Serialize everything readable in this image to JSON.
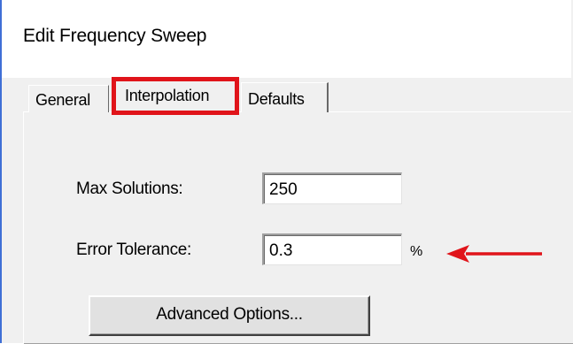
{
  "dialog": {
    "title": "Edit Frequency Sweep"
  },
  "tabs": [
    {
      "label": "General",
      "active": false
    },
    {
      "label": "Interpolation",
      "active": true,
      "highlighted": true
    },
    {
      "label": "Defaults",
      "active": false
    }
  ],
  "form": {
    "max_solutions": {
      "label": "Max Solutions:",
      "value": "250"
    },
    "error_tolerance": {
      "label": "Error Tolerance:",
      "value": "0.3",
      "unit": "%"
    }
  },
  "advanced_button": {
    "label": "Advanced Options..."
  },
  "annotation": {
    "arrow_target": "error-tolerance",
    "arrow_color": "#e0141a",
    "highlight_color": "#e0141a"
  },
  "colors": {
    "dialog_bg": "#f0f0f0",
    "window_border": "#3f6fd6",
    "accent_red": "#e0141a"
  }
}
